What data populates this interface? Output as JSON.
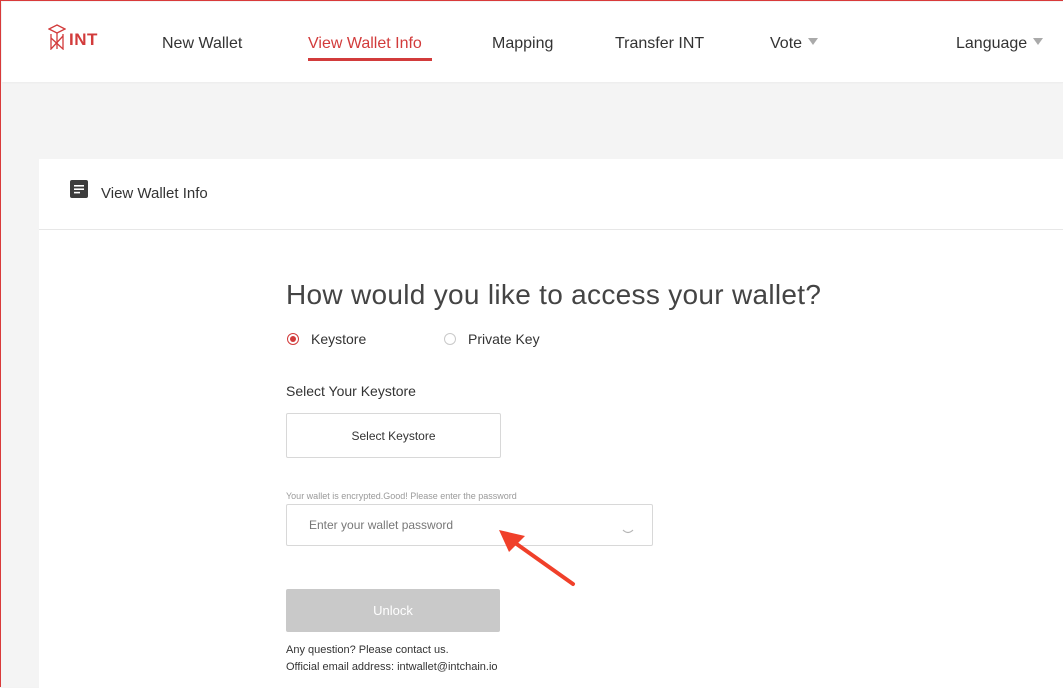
{
  "header": {
    "logo_text": "INT",
    "nav": [
      {
        "label": "New Wallet"
      },
      {
        "label": "View Wallet Info"
      },
      {
        "label": "Mapping"
      },
      {
        "label": "Transfer INT"
      },
      {
        "label": "Vote"
      }
    ],
    "language_label": "Language",
    "active_nav": "View Wallet Info"
  },
  "card": {
    "title": "View Wallet Info",
    "heading": "How would you like to access your wallet?",
    "options": [
      {
        "label": "Keystore",
        "checked": true
      },
      {
        "label": "Private Key",
        "checked": false
      }
    ],
    "keystore_section_label": "Select Your Keystore",
    "select_keystore_label": "Select Keystore",
    "password_hint": "Your wallet is encrypted.Good! Please enter the password",
    "password_placeholder": "Enter your wallet password",
    "unlock_label": "Unlock",
    "contact_line1": "Any question? Please contact us.",
    "contact_line2": "Official email address: intwallet@intchain.io"
  },
  "colors": {
    "accent": "#d23b3b",
    "annotation_arrow": "#f0402a",
    "disabled_button": "#c9c9c9"
  },
  "icons": [
    "int-logo-icon",
    "document-icon",
    "eye-icon",
    "caret-down-icon",
    "annotation-arrow-icon"
  ]
}
